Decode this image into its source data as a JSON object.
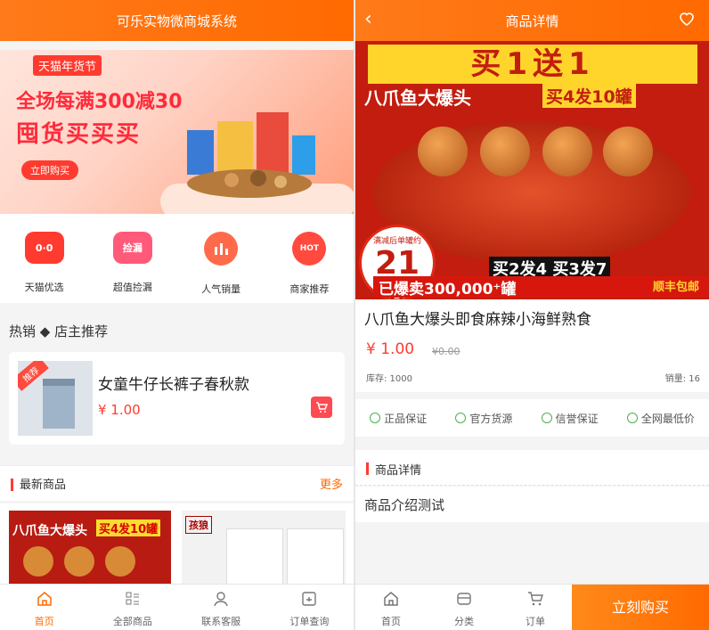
{
  "left": {
    "title": "可乐实物微商城系统",
    "banner": {
      "tag": "天猫年货节",
      "line1": "全场每满300减30",
      "line2": "囤货买买买",
      "button": "立即购买"
    },
    "icons": [
      {
        "label": "天猫优选",
        "glyph": "0·0",
        "color": "#ff3b30"
      },
      {
        "label": "超值捡漏",
        "glyph": "捡漏",
        "color": "#ff5a7a"
      },
      {
        "label": "人气销量",
        "glyph": "",
        "color": "#ff6a4a"
      },
      {
        "label": "商家推荐",
        "glyph": "HOT",
        "color": "#ff4a3d"
      }
    ],
    "hot_title": "热销 ◆ 店主推荐",
    "hot_item": {
      "badge": "推荐",
      "name": "女童牛仔长裤子春秋款",
      "price": "¥ 1.00"
    },
    "new_title": "最新商品",
    "new_more": "更多",
    "new_item1": {
      "text1": "八爪鱼大爆头",
      "text2": "买4发10罐"
    },
    "new_item2": {
      "logo": "孩狼"
    },
    "nav": [
      {
        "label": "首页",
        "icon": "home-icon",
        "active": true
      },
      {
        "label": "全部商品",
        "icon": "grid-list-icon",
        "active": false
      },
      {
        "label": "联系客服",
        "icon": "user-icon",
        "active": false
      },
      {
        "label": "订单查询",
        "icon": "order-icon",
        "active": false
      }
    ]
  },
  "right": {
    "title": "商品详情",
    "hero": {
      "headline": "买1送1",
      "sub": "八爪鱼大爆头",
      "sub2": "买4发10罐",
      "badge_small": "满减后单罐约",
      "badge_price": "21元",
      "promo": "买2发4  买3发7",
      "sold": "已爆卖300,000⁺罐",
      "ship": "顺丰包邮"
    },
    "product_name": "八爪鱼大爆头即食麻辣小海鲜熟食",
    "price": "¥ 1.00",
    "orig_price": "¥0.00",
    "stock": "库存: 1000",
    "sales": "销量: 16",
    "guarantees": [
      "正品保证",
      "官方货源",
      "信誉保证",
      "全网最低价"
    ],
    "detail_title": "商品详情",
    "detail_body": "商品介绍测试",
    "nav": [
      {
        "label": "首页",
        "icon": "home-icon"
      },
      {
        "label": "分类",
        "icon": "category-icon"
      },
      {
        "label": "订单",
        "icon": "cart-icon"
      }
    ],
    "buy_button": "立刻购买"
  }
}
